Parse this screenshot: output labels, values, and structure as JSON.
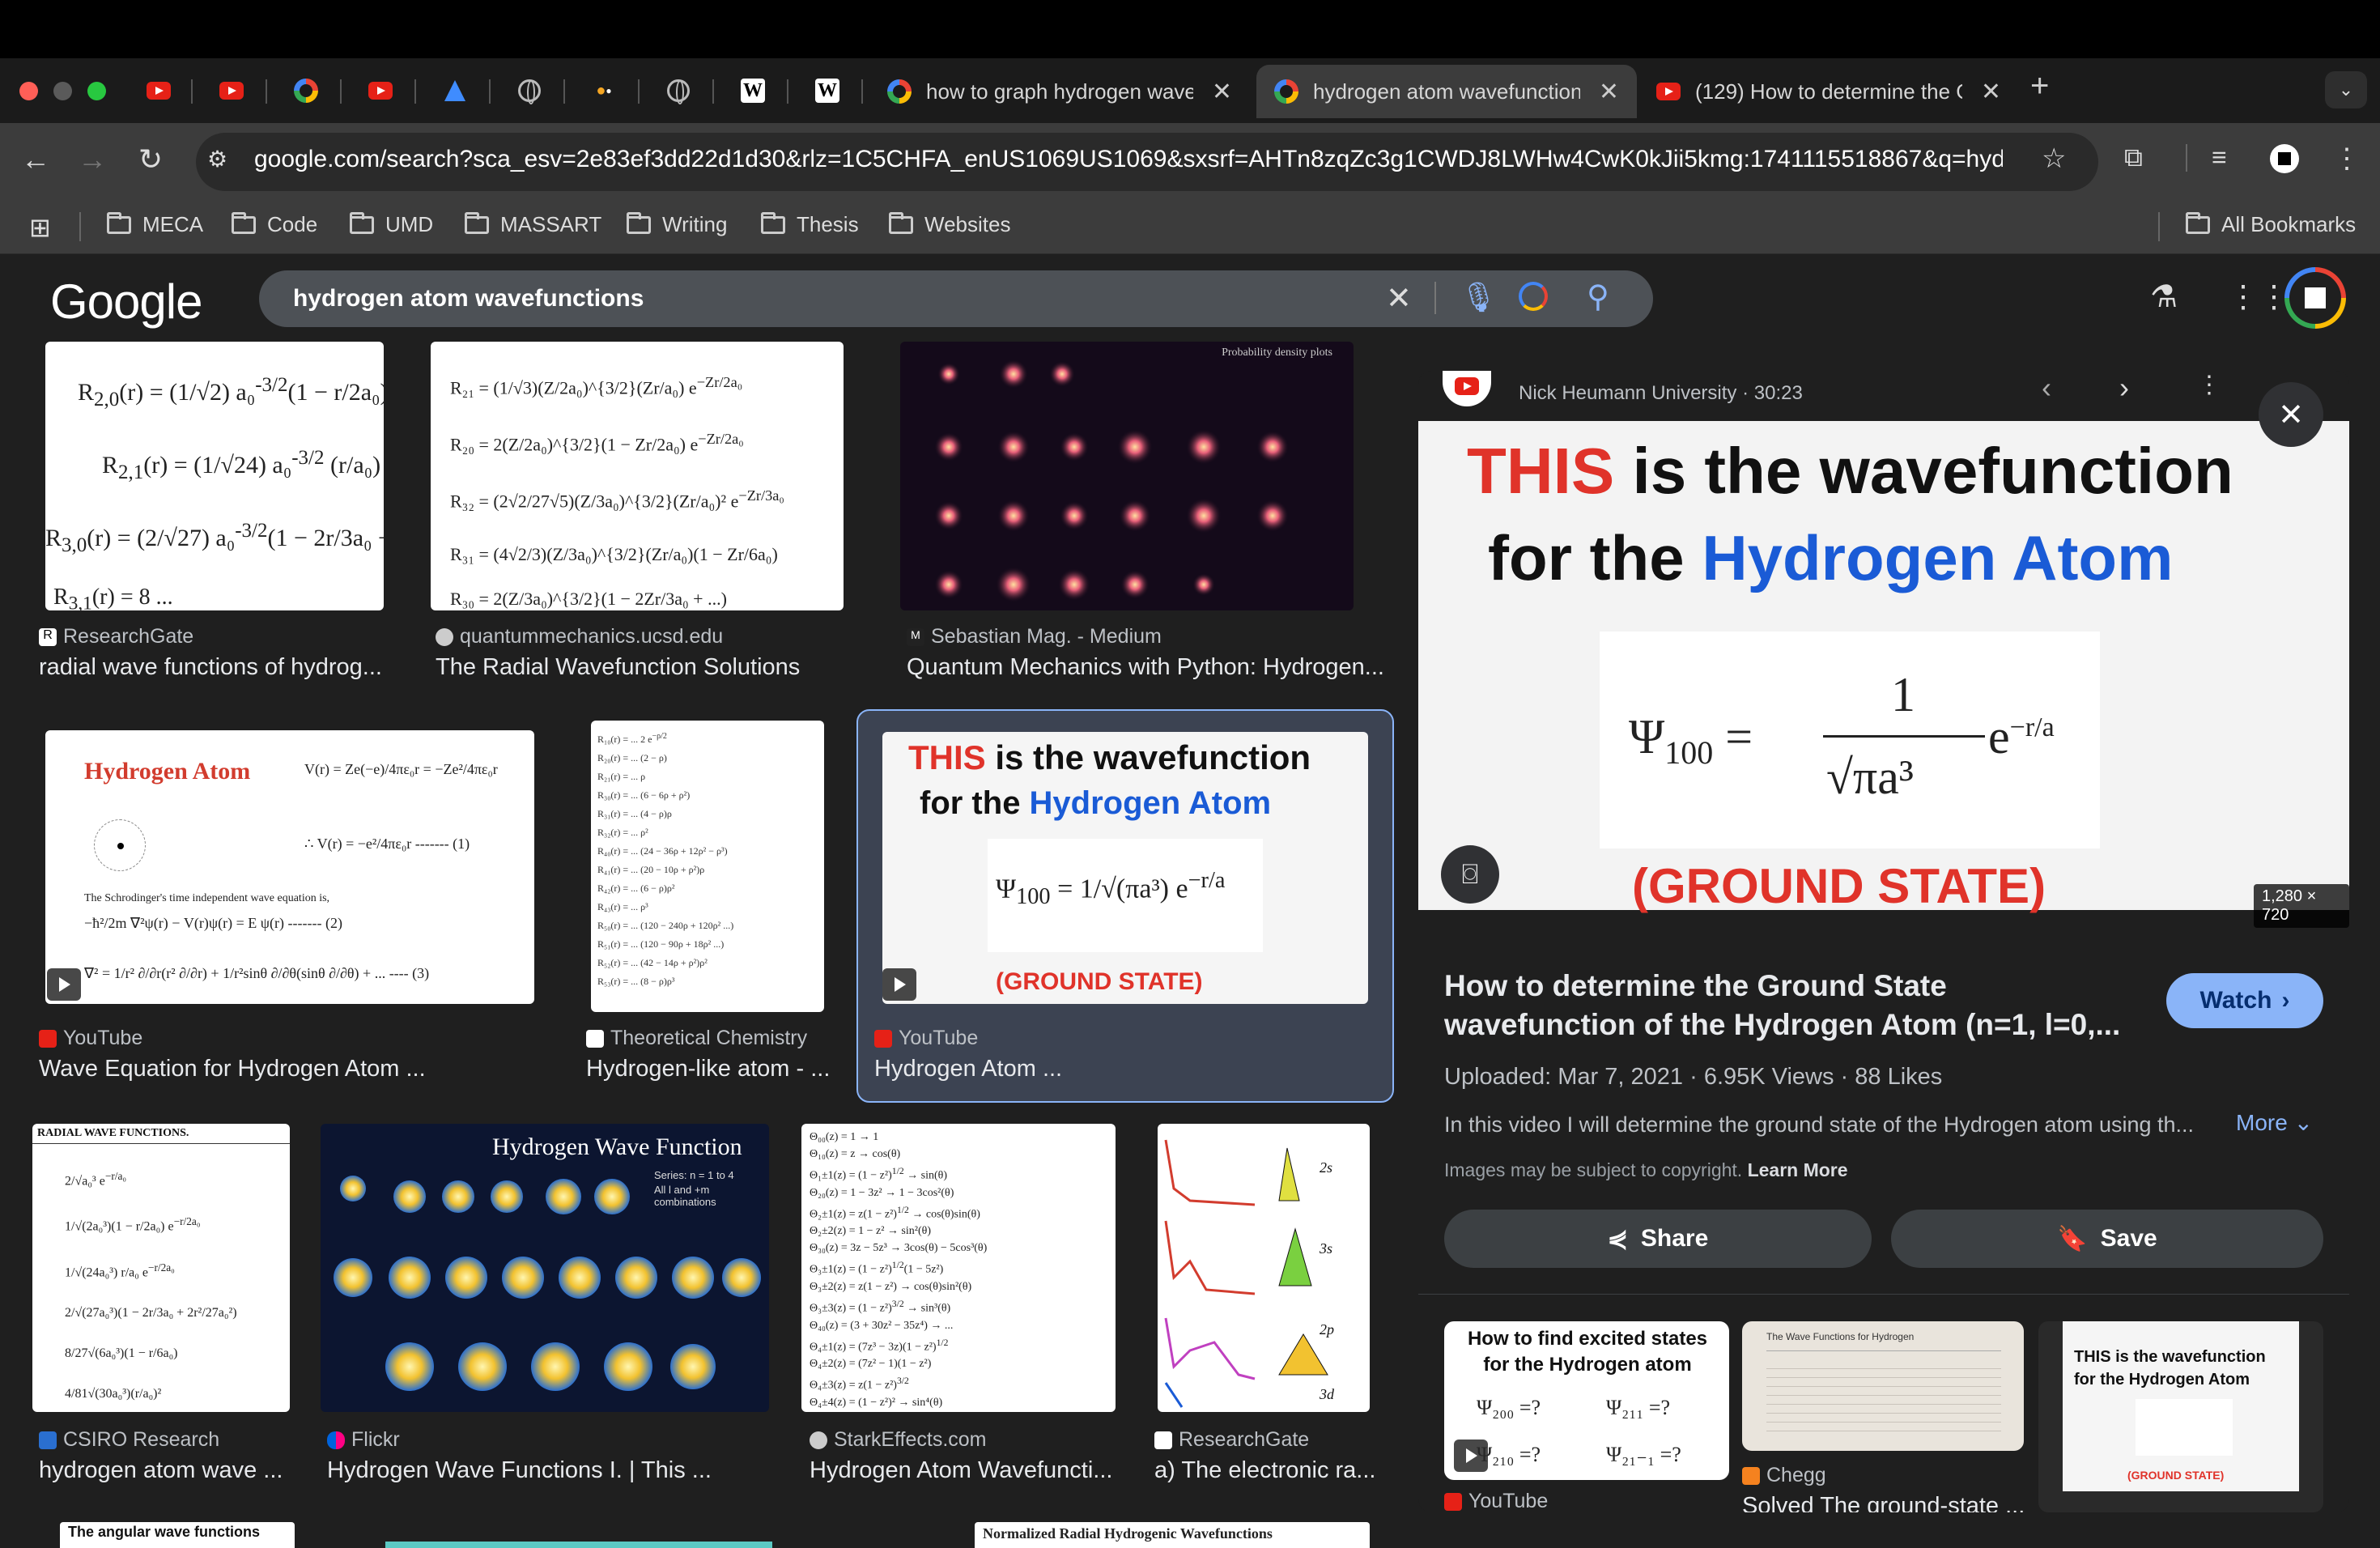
{
  "browser": {
    "tabs": [
      {
        "title": "how to graph hydrogen wave"
      },
      {
        "title": "hydrogen atom wavefunctions"
      },
      {
        "title": "(129) How to determine the G"
      }
    ],
    "url": "google.com/search?sca_esv=2e83ef3dd22d1d30&rlz=1C5CHFA_enUS1069US1069&sxsrf=AHTn8zqZc3g1CWDJ8LWHw4CwK0kJii5kmg:1741115518867&q=hydro...",
    "bookmarks": [
      "MECA",
      "Code",
      "UMD",
      "MASSART",
      "Writing",
      "Thesis",
      "Websites"
    ],
    "all_bookmarks": "All Bookmarks"
  },
  "google": {
    "logo": "Google",
    "query": "hydrogen atom wavefunctions"
  },
  "results": [
    {
      "source": "ResearchGate",
      "title": "radial wave functions of hydrog..."
    },
    {
      "source": "quantummechanics.ucsd.edu",
      "title": "The Radial Wavefunction Solutions"
    },
    {
      "source": "Sebastian Mag. - Medium",
      "title": "Quantum Mechanics with Python: Hydrogen..."
    },
    {
      "source": "YouTube",
      "title": "Wave Equation for Hydrogen Atom ..."
    },
    {
      "source": "Theoretical Chemistry",
      "title": "Hydrogen-like atom - ..."
    },
    {
      "source": "YouTube",
      "title": "Hydrogen Atom ..."
    },
    {
      "source": "CSIRO Research",
      "title": "hydrogen atom wave ..."
    },
    {
      "source": "Flickr",
      "title": "Hydrogen Wave Functions I. | This ..."
    },
    {
      "source": "StarkEffects.com",
      "title": "Hydrogen Atom Wavefuncti..."
    },
    {
      "source": "ResearchGate",
      "title": "a) The electronic ra..."
    }
  ],
  "thumbs": {
    "hydrogen_atom": "Hydrogen Atom",
    "hydrogen_wave_function": "Hydrogen Wave Function",
    "series_note": "Series: n = 1 to 4",
    "series_note2": "All l and +m combinations",
    "prob_density": "Probability density plots",
    "radial_table": "RADIAL WAVE FUNCTIONS.",
    "angular": "The angular wave functions",
    "normalized": "Normalized Radial Hydrogenic Wavefunctions"
  },
  "panel": {
    "channel": "Nick Heumann University · 30:23",
    "hero_line1_a": "THIS",
    "hero_line1_b": " is the wavefunction",
    "hero_line2_a": "for the ",
    "hero_line2_b": "Hydrogen Atom",
    "hero_footer": "(GROUND STATE)",
    "image_size": "1,280 × 720",
    "title": "How to determine the Ground State wavefunction of the Hydrogen Atom (n=1, l=0,...",
    "watch": "Watch",
    "uploaded": "Uploaded: Mar 7, 2021",
    "views": "6.95K Views",
    "likes": "88 Likes",
    "description": "In this video I will determine the ground state of the Hydrogen atom using th...",
    "more": "More",
    "copyright": "Images may be subject to copyright.",
    "learn_more": "Learn More",
    "share": "Share",
    "save": "Save",
    "related": [
      {
        "heading": "How to find excited states for the Hydrogen atom",
        "source": "YouTube"
      },
      {
        "heading": "The Wave Functions for Hydrogen",
        "source": "Chegg",
        "title": "Solved The ground-state ..."
      },
      {
        "heading": "THIS is the wavefunction for the Hydrogen Atom",
        "footer": "(GROUND STATE)"
      }
    ]
  },
  "colors": {
    "red": "#e0332a",
    "blue": "#1a5bd6",
    "panel_bg": "#1f1f1f",
    "accent_btn": "#8ab4f8"
  }
}
